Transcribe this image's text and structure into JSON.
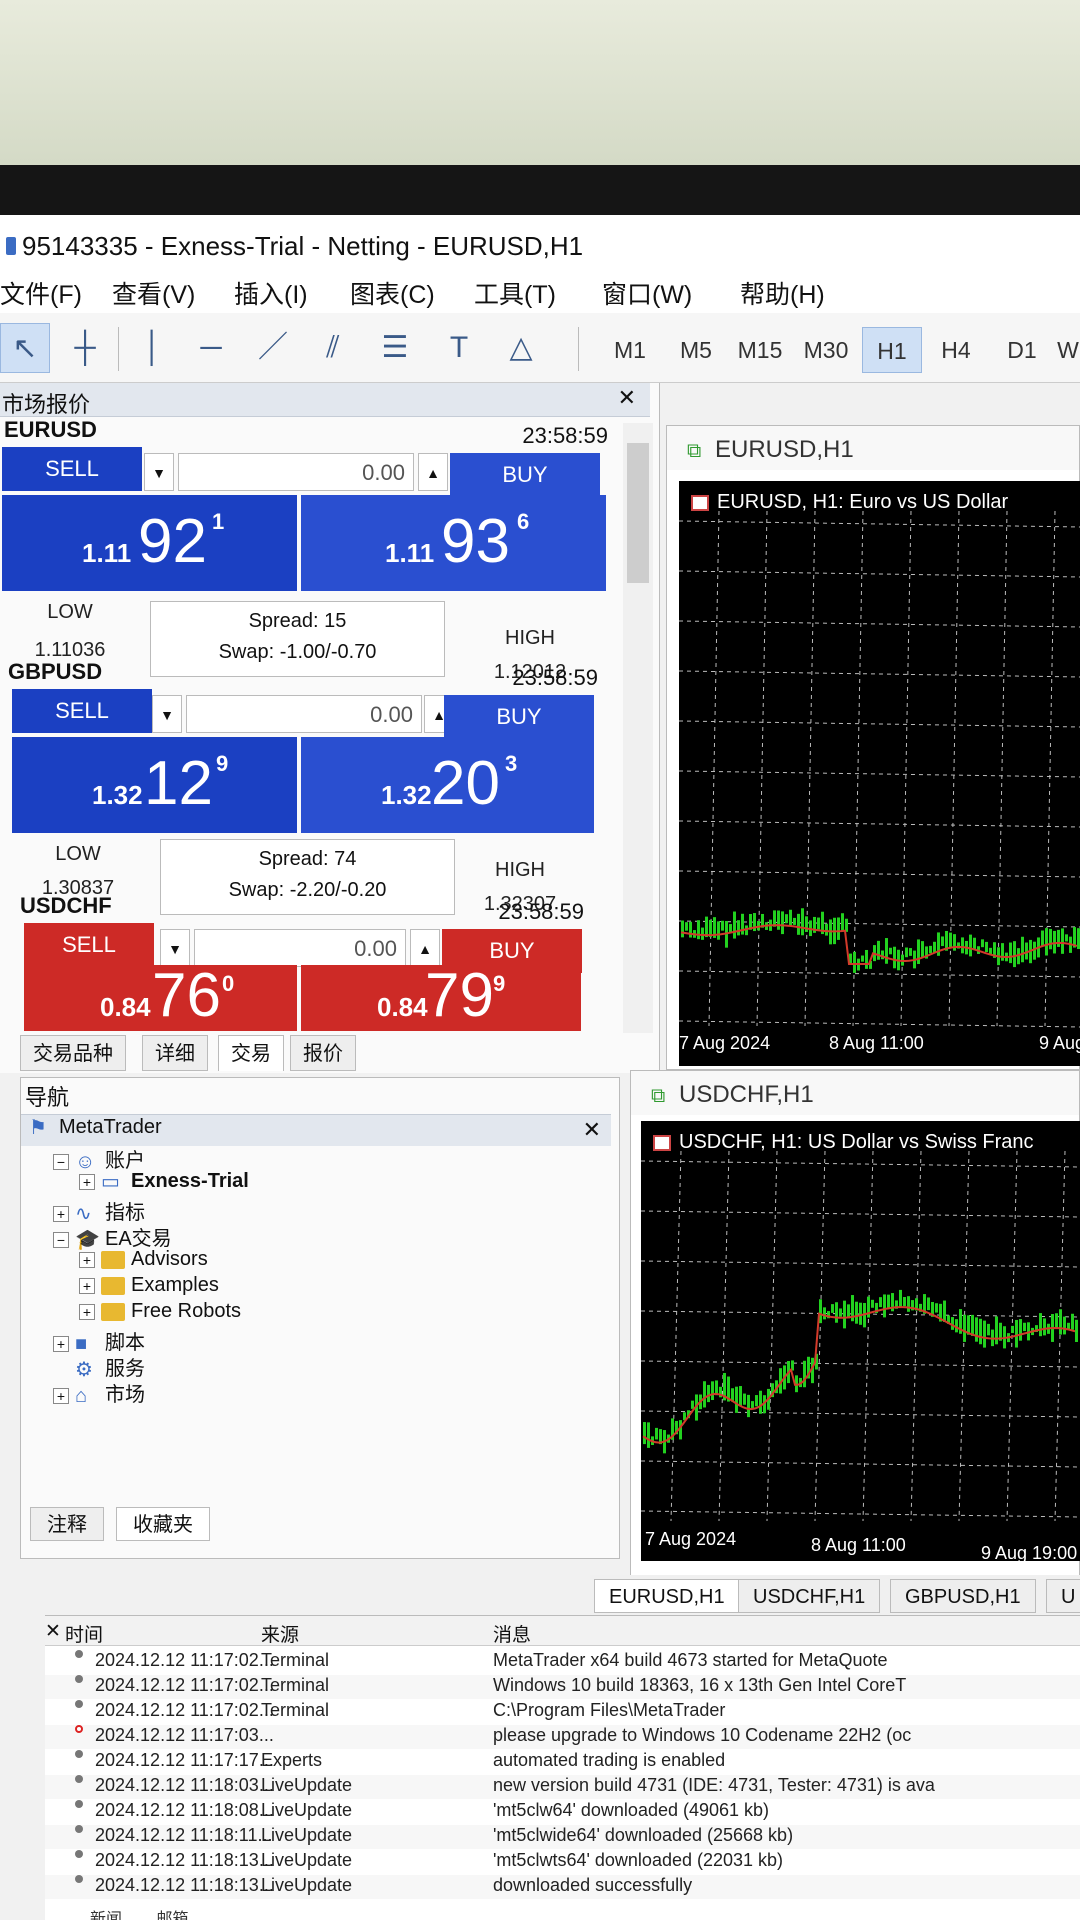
{
  "window": {
    "title": "95143335 - Exness-Trial - Netting - EURUSD,H1"
  },
  "menu": [
    "文件(F)",
    "查看(V)",
    "插入(I)",
    "图表(C)",
    "工具(T)",
    "窗口(W)",
    "帮助(H)"
  ],
  "toolbar": {
    "tools": [
      {
        "name": "cursor-icon",
        "glyph": "↖"
      },
      {
        "name": "crosshair-icon",
        "glyph": "┼"
      },
      {
        "name": "vertical-line-icon",
        "glyph": "│"
      },
      {
        "name": "horizontal-line-icon",
        "glyph": "─"
      },
      {
        "name": "trendline-icon",
        "glyph": "／"
      },
      {
        "name": "channel-icon",
        "glyph": "⫽"
      },
      {
        "name": "fibonacci-icon",
        "glyph": "☰"
      },
      {
        "name": "text-icon",
        "glyph": "T"
      },
      {
        "name": "shapes-icon",
        "glyph": "△"
      }
    ],
    "timeframes": [
      "M1",
      "M5",
      "M15",
      "M30",
      "H1",
      "H4",
      "D1",
      "W"
    ],
    "active_timeframe": "H1"
  },
  "market_watch": {
    "title": "市场报价",
    "symbols": [
      {
        "symbol": "EURUSD",
        "time": "23:58:59",
        "sell_label": "SELL",
        "buy_label": "BUY",
        "lot": "0.00",
        "bid_small": "1.11",
        "bid_big": "92",
        "bid_sup": "1",
        "ask_small": "1.11",
        "ask_big": "93",
        "ask_sup": "6",
        "low_label": "LOW",
        "low": "1.11036",
        "high_label": "HIGH",
        "high": "1.12012",
        "spread": "Spread: 15",
        "swap": "Swap: -1.00/-0.70",
        "color": "blue"
      },
      {
        "symbol": "GBPUSD",
        "time": "23:58:59",
        "sell_label": "SELL",
        "buy_label": "BUY",
        "lot": "0.00",
        "bid_small": "1.32",
        "bid_big": "12",
        "bid_sup": "9",
        "ask_small": "1.32",
        "ask_big": "20",
        "ask_sup": "3",
        "low_label": "LOW",
        "low": "1.30837",
        "high_label": "HIGH",
        "high": "1.32307",
        "spread": "Spread: 74",
        "swap": "Swap: -2.20/-0.20",
        "color": "blue"
      },
      {
        "symbol": "USDCHF",
        "time": "23:58:59",
        "sell_label": "SELL",
        "buy_label": "BUY",
        "lot": "0.00",
        "bid_small": "0.84",
        "bid_big": "76",
        "bid_sup": "0",
        "ask_small": "0.84",
        "ask_big": "79",
        "ask_sup": "9",
        "color": "red"
      }
    ],
    "tabs": [
      "交易品种",
      "详细",
      "交易",
      "报价"
    ],
    "active_tab": "交易"
  },
  "navigator": {
    "title": "导航",
    "root": "MetaTrader",
    "items": [
      {
        "label": "账户",
        "indent": 1,
        "icon": "accounts-icon",
        "expand": "−"
      },
      {
        "label": "Exness-Trial",
        "indent": 2,
        "icon": "account-icon",
        "expand": "+",
        "bold": true
      },
      {
        "label": "指标",
        "indent": 1,
        "icon": "indicators-icon",
        "expand": "+"
      },
      {
        "label": "EA交易",
        "indent": 1,
        "icon": "expert-icon",
        "expand": "−"
      },
      {
        "label": "Advisors",
        "indent": 2,
        "icon": "folder-icon",
        "expand": "+"
      },
      {
        "label": "Examples",
        "indent": 2,
        "icon": "folder-icon",
        "expand": "+"
      },
      {
        "label": "Free Robots",
        "indent": 2,
        "icon": "folder-icon",
        "expand": "+"
      },
      {
        "label": "脚本",
        "indent": 1,
        "icon": "scripts-icon",
        "expand": "+"
      },
      {
        "label": "服务",
        "indent": 1,
        "icon": "services-icon",
        "expand": ""
      },
      {
        "label": "市场",
        "indent": 1,
        "icon": "market-icon",
        "expand": "+"
      }
    ],
    "tabs": [
      "注释",
      "收藏夹"
    ]
  },
  "charts": [
    {
      "window_title": "EURUSD,H1",
      "label": "EURUSD, H1:  Euro vs US Dollar",
      "x_labels": [
        "7 Aug 2024",
        "8 Aug 11:00",
        "9 Aug"
      ]
    },
    {
      "window_title": "USDCHF,H1",
      "label": "USDCHF, H1:  US Dollar vs Swiss Franc",
      "x_labels": [
        "7 Aug 2024",
        "8 Aug 11:00",
        "9 Aug 19:00"
      ]
    }
  ],
  "chart_tabs": [
    "EURUSD,H1",
    "USDCHF,H1",
    "GBPUSD,H1",
    "U"
  ],
  "journal": {
    "headers": {
      "time": "时间",
      "source": "来源",
      "message": "消息"
    },
    "rows": [
      {
        "time": "2024.12.12 11:17:02...",
        "source": "Terminal",
        "message": "MetaTrader x64 build 4673 started for MetaQuote",
        "err": false
      },
      {
        "time": "2024.12.12 11:17:02...",
        "source": "Terminal",
        "message": "Windows 10 build 18363, 16 x 13th Gen Intel CoreT",
        "err": false
      },
      {
        "time": "2024.12.12 11:17:02...",
        "source": "Terminal",
        "message": "C:\\Program Files\\MetaTrader",
        "err": false
      },
      {
        "time": "2024.12.12 11:17:03...",
        "source": "",
        "message": "please upgrade to Windows 10 Codename 22H2 (oc",
        "err": true
      },
      {
        "time": "2024.12.12 11:17:17...",
        "source": "Experts",
        "message": "automated trading is enabled",
        "err": false
      },
      {
        "time": "2024.12.12 11:18:03...",
        "source": "LiveUpdate",
        "message": "new version build 4731 (IDE: 4731, Tester: 4731) is ava",
        "err": false
      },
      {
        "time": "2024.12.12 11:18:08...",
        "source": "LiveUpdate",
        "message": "'mt5clw64' downloaded (49061 kb)",
        "err": false
      },
      {
        "time": "2024.12.12 11:18:11...",
        "source": "LiveUpdate",
        "message": "'mt5clwide64' downloaded (25668 kb)",
        "err": false
      },
      {
        "time": "2024.12.12 11:18:13...",
        "source": "LiveUpdate",
        "message": "'mt5clwts64' downloaded (22031 kb)",
        "err": false
      },
      {
        "time": "2024.12.12 11:18:13...",
        "source": "LiveUpdate",
        "message": "downloaded successfully",
        "err": false
      }
    ],
    "bottom_tabs": [
      "新闻",
      "邮箱"
    ]
  },
  "colors": {
    "sell_blue": "#1b40c2",
    "buy_blue": "#2a4fd0",
    "sell_red": "#cd2a26",
    "bull_green": "#22d11f",
    "ma_red": "#d33a2a"
  }
}
